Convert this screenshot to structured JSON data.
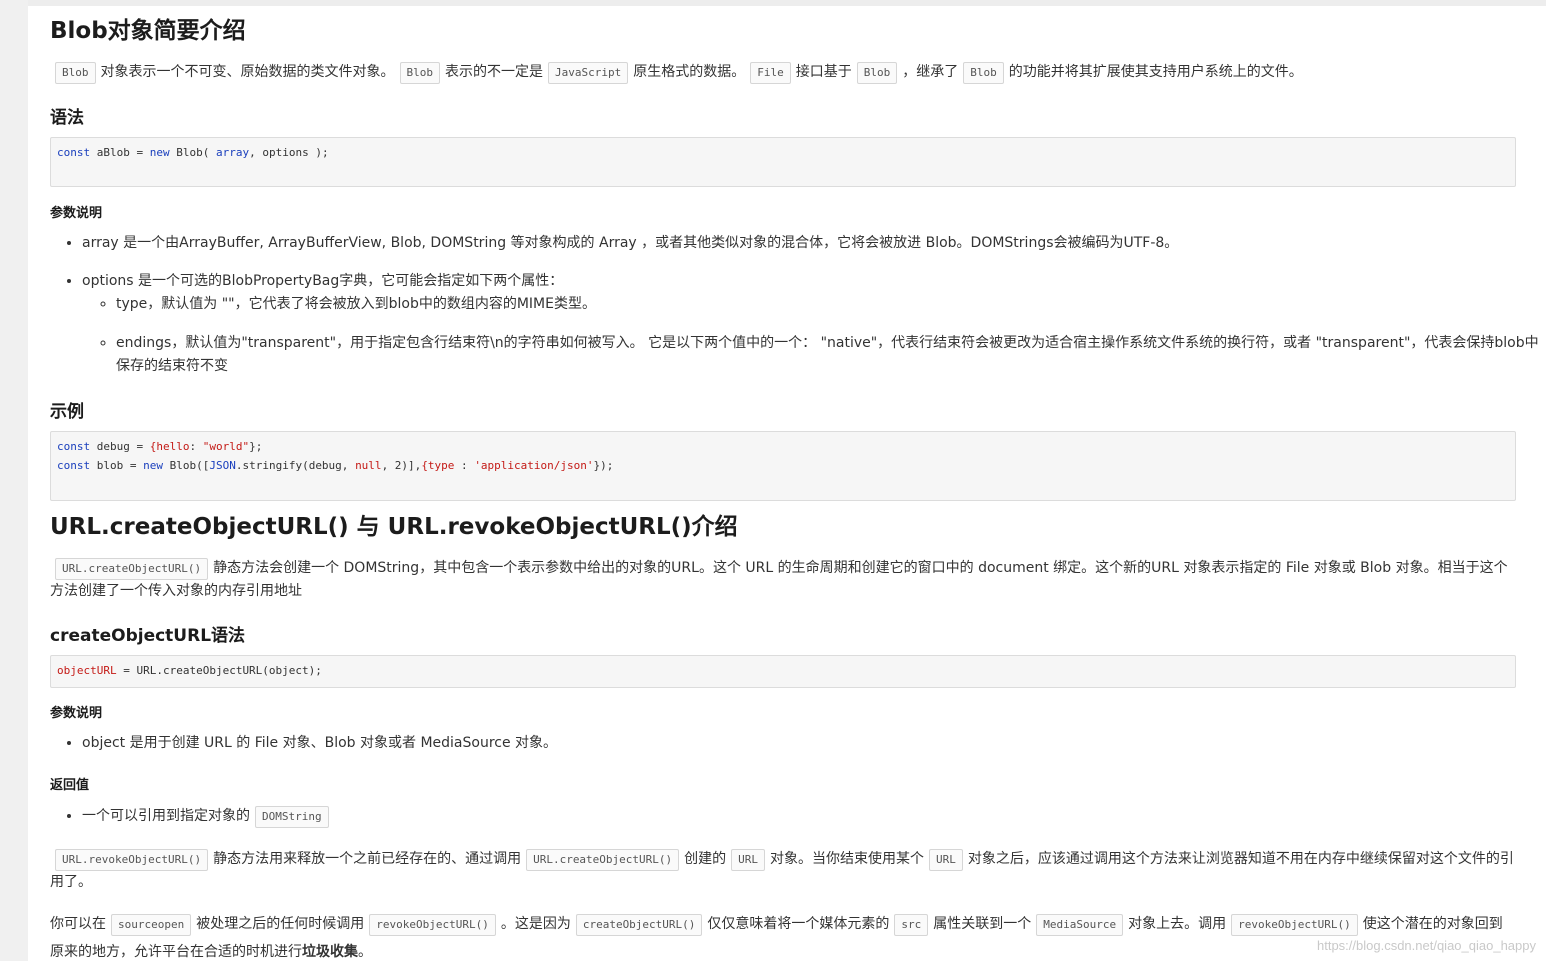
{
  "s1": {
    "title": "Blob对象简要介绍",
    "intro": {
      "c1": "Blob",
      "t1": "对象表示一个不可变、原始数据的类文件对象。",
      "c2": "Blob",
      "t2": "表示的不一定是",
      "c3": "JavaScript",
      "t3": "原生格式的数据。",
      "c4": "File",
      "t4": "接口基于",
      "c5": "Blob",
      "t5": "，继承了",
      "c6": "Blob",
      "t6": "的功能并将其扩展使其支持用户系统上的文件。"
    },
    "syntax_heading": "语法",
    "syntax_code": {
      "k1": "const",
      "t1": " aBlob = ",
      "k2": "new",
      "t2": " Blob( ",
      "k3": "array",
      "t3": ", options );"
    },
    "params_heading": "参数说明",
    "param_array": "array 是一个由ArrayBuffer, ArrayBufferView, Blob, DOMString 等对象构成的 Array ，或者其他类似对象的混合体，它将会被放进 Blob。DOMStrings会被编码为UTF-8。",
    "param_options": "options 是一个可选的BlobPropertyBag字典，它可能会指定如下两个属性：",
    "option_type": "type，默认值为 \"\"，它代表了将会被放入到blob中的数组内容的MIME类型。",
    "option_endings": "endings，默认值为\"transparent\"，用于指定包含行结束符\\n的字符串如何被写入。 它是以下两个值中的一个： \"native\"，代表行结束符会被更改为适合宿主操作系统文件系统的换行符，或者 \"transparent\"，代表会保持blob中保存的结束符不变",
    "example_heading": "示例",
    "example": {
      "l1k1": "const",
      "l1t1": " debug = ",
      "l1s1": "{hello",
      "l1t2": ": ",
      "l1s2": "\"world\"",
      "l1t3": "};",
      "l2k1": "const",
      "l2t1": " blob = ",
      "l2k2": "new",
      "l2t2": " Blob([",
      "l2k3": "JSON",
      "l2t3": ".stringify(debug, ",
      "l2s1": "null",
      "l2t4": ", 2)],",
      "l2s2": "{type",
      "l2t5": " : ",
      "l2s3": "'application/json'",
      "l2t6": "});"
    }
  },
  "s2": {
    "title": "URL.createObjectURL() 与 URL.revokeObjectURL()介绍",
    "intro": {
      "c1": "URL.createObjectURL()",
      "t1": "静态方法会创建一个 DOMString，其中包含一个表示参数中给出的对象的URL。这个 URL 的生命周期和创建它的窗口中的 document 绑定。这个新的URL 对象表示指定的 File 对象或 Blob 对象。相当于这个方法创建了一个传入对象的内存引用地址"
    },
    "syntax_heading": "createObjectURL语法",
    "syntax_code": {
      "id": "objectURL",
      "t1": " = URL.createObjectURL(object);"
    },
    "params_heading": "参数说明",
    "param_object": "object 是用于创建 URL 的 File 对象、Blob 对象或者 MediaSource 对象。",
    "return_heading": "返回值",
    "return_text": "一个可以引用到指定对象的",
    "return_code": "DOMString",
    "revoke": {
      "c1": "URL.revokeObjectURL()",
      "t1": "静态方法用来释放一个之前已经存在的、通过调用",
      "c2": "URL.createObjectURL()",
      "t2": "创建的",
      "c3": "URL",
      "t3": "对象。当你结束使用某个",
      "c4": "URL",
      "t4": "对象之后，应该通过调用这个方法来让浏览器知道不用在内存中继续保留对这个文件的引用了。"
    },
    "when": {
      "t1": "你可以在",
      "c1": "sourceopen",
      "t2": "被处理之后的任何时候调用",
      "c2": "revokeObjectURL()",
      "t3": "。这是因为",
      "c3": "createObjectURL()",
      "t4": "仅仅意味着将一个媒体元素的",
      "c4": "src",
      "t5": "属性关联到一个",
      "c5": "MediaSource",
      "t6": "对象上去。调用",
      "c6": "revokeObjectURL()",
      "t7": "使这个潜在的对象回到原来的地方，允许平台在合适的时机进行",
      "b1": "垃圾收集",
      "t8": "。"
    }
  },
  "watermark": "https://blog.csdn.net/qiao_qiao_happy"
}
